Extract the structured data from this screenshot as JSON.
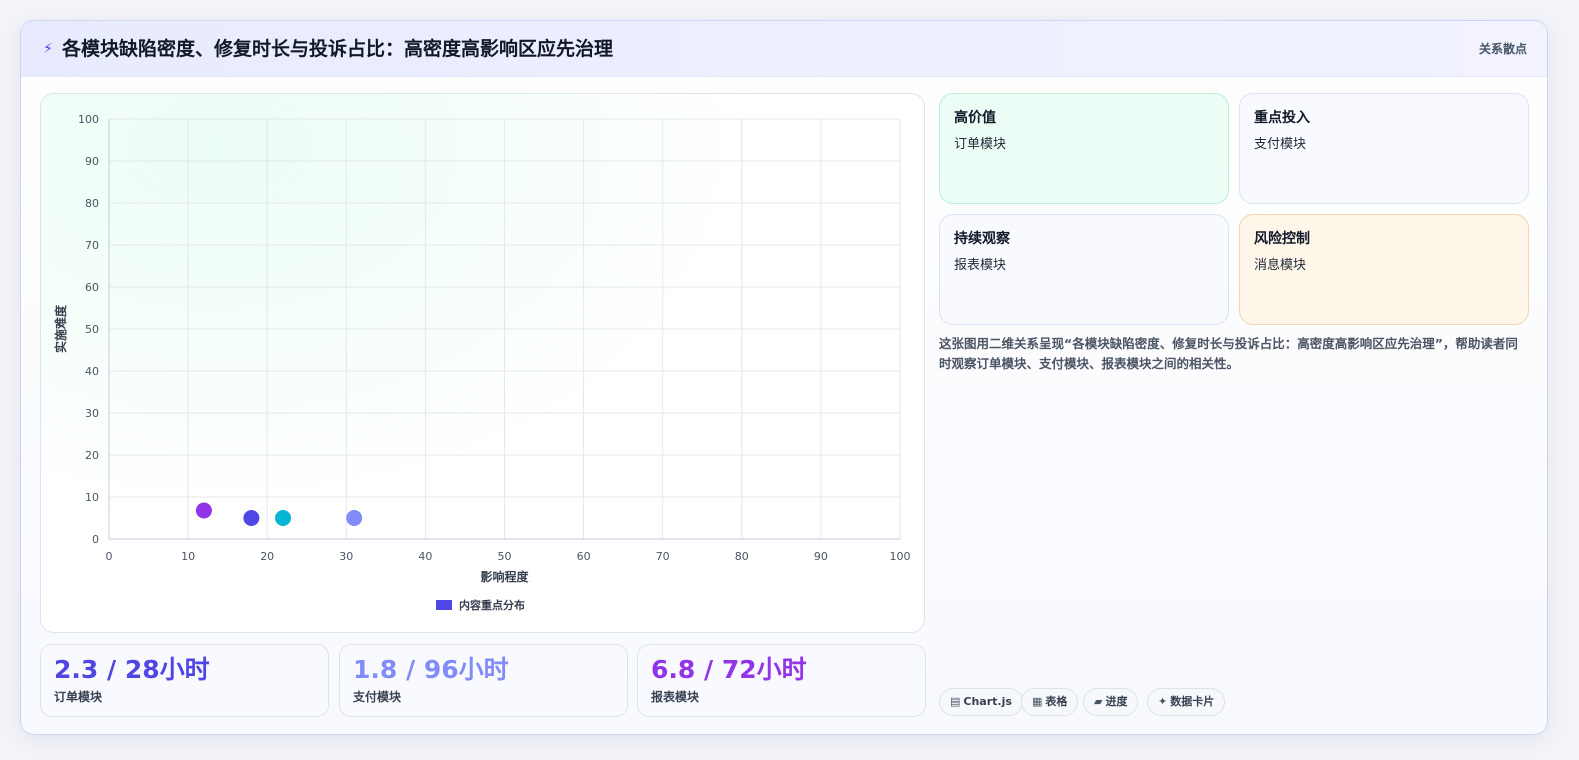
{
  "header": {
    "title": "各模块缺陷密度、修复时长与投诉占比：高密度高影响区应先治理",
    "tag": "关系散点",
    "icon": "bolt-icon"
  },
  "chart_data": {
    "type": "scatter",
    "xlabel": "影响程度",
    "ylabel": "实施难度",
    "xlim": [
      0,
      100
    ],
    "ylim": [
      0,
      100
    ],
    "xticks": [
      0,
      10,
      20,
      30,
      40,
      50,
      60,
      70,
      80,
      90,
      100
    ],
    "yticks": [
      0,
      10,
      20,
      30,
      40,
      50,
      60,
      70,
      80,
      90,
      100
    ],
    "grid": true,
    "legend": {
      "position": "bottom",
      "label": "内容重点分布",
      "color": "#4f46e5"
    },
    "points": [
      {
        "x": 12,
        "y": 6.8,
        "color": "#9333ea"
      },
      {
        "x": 18,
        "y": 5,
        "color": "#4f46e5"
      },
      {
        "x": 22,
        "y": 5,
        "color": "#06b6d4"
      },
      {
        "x": 31,
        "y": 5,
        "color": "#818cf8"
      }
    ]
  },
  "stats": [
    {
      "value": "2.3 / 28小时",
      "label": "订单模块",
      "color": "#4f46e5"
    },
    {
      "value": "1.8 / 96小时",
      "label": "支付模块",
      "color": "#818cf8"
    },
    {
      "value": "6.8 / 72小时",
      "label": "报表模块",
      "color": "#9333ea"
    }
  ],
  "quadrants": [
    {
      "title": "高价值",
      "item": "订单模块"
    },
    {
      "title": "重点投入",
      "item": "支付模块"
    },
    {
      "title": "持续观察",
      "item": "报表模块"
    },
    {
      "title": "风险控制",
      "item": "消息模块"
    }
  ],
  "description": "这张图用二维关系呈现“各模块缺陷密度、修复时长与投诉占比：高密度高影响区应先治理”，帮助读者同时观察订单模块、支付模块、报表模块之间的相关性。",
  "chips": [
    {
      "icon": "chart-icon",
      "glyph": "▤",
      "label": "Chart.js"
    },
    {
      "icon": "table-icon",
      "glyph": "▦",
      "label": "表格"
    },
    {
      "icon": "progress-icon",
      "glyph": "▰",
      "label": "进度"
    },
    {
      "icon": "sparkle-icon",
      "glyph": "✦",
      "label": "数据卡片"
    }
  ]
}
